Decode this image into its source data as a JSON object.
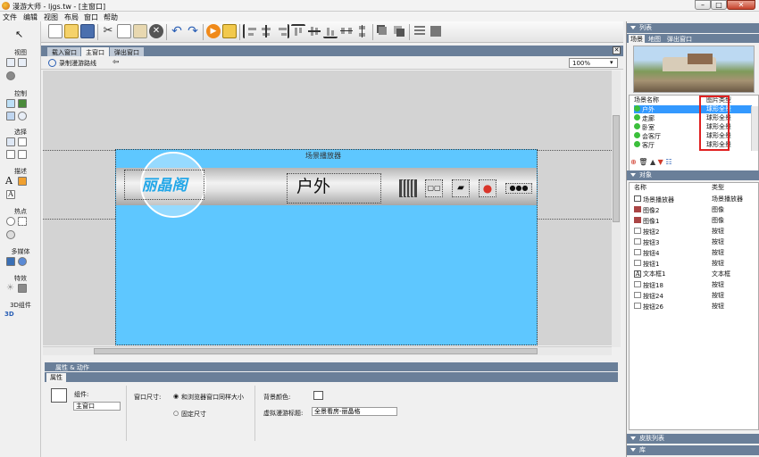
{
  "window": {
    "title": "漫游大师 - ljgs.tw - [主窗口]"
  },
  "menu": [
    "文件",
    "编辑",
    "视图",
    "布局",
    "窗口",
    "帮助"
  ],
  "left_toolbox": {
    "groups": [
      "视图",
      "控制",
      "选择",
      "描述",
      "热点",
      "多媒体",
      "特效",
      "3D组件"
    ]
  },
  "tabs": [
    "载入窗口",
    "主窗口",
    "弹出窗口"
  ],
  "subbar": {
    "record_label": "录制漫游路线",
    "zoom": "100%"
  },
  "canvas": {
    "player_label": "场景播放器",
    "logo_text": "丽晶阁",
    "scene_title": "户外"
  },
  "props": {
    "header": "属性 & 动作",
    "tab": "属性",
    "component_label": "组件:",
    "component_value": "主窗口",
    "window_size_label": "窗口尺寸:",
    "radio1": "和浏览器窗口同样大小",
    "radio2": "固定尺寸",
    "bg_color_label": "背景颜色:",
    "tour_title_label": "虚拟漫游标题:",
    "tour_title_value": "全景看房-丽晶格"
  },
  "right": {
    "list_header": "列表",
    "list_tabs": [
      "场景",
      "地图",
      "弹出窗口"
    ],
    "scene_cols": [
      "场景名称",
      "图片类型"
    ],
    "scenes": [
      {
        "name": "户外",
        "type": "球形全景"
      },
      {
        "name": "走廊",
        "type": "球形全景"
      },
      {
        "name": "卧室",
        "type": "球形全景"
      },
      {
        "name": "会客厅",
        "type": "球形全景"
      },
      {
        "name": "客厅",
        "type": "球形全景"
      }
    ],
    "objects_header": "对象",
    "obj_cols": [
      "名称",
      "类型"
    ],
    "objects": [
      {
        "name": "场景播放器",
        "type": "场景播放器"
      },
      {
        "name": "图像2",
        "type": "图像"
      },
      {
        "name": "图像1",
        "type": "图像"
      },
      {
        "name": "按钮2",
        "type": "按钮"
      },
      {
        "name": "按钮3",
        "type": "按钮"
      },
      {
        "name": "按钮4",
        "type": "按钮"
      },
      {
        "name": "按钮1",
        "type": "按钮"
      },
      {
        "name": "文本框1",
        "type": "文本框"
      },
      {
        "name": "按钮18",
        "type": "按钮"
      },
      {
        "name": "按钮24",
        "type": "按钮"
      },
      {
        "name": "按钮26",
        "type": "按钮"
      }
    ],
    "skin_header": "皮肤列表",
    "lib_header": "库"
  },
  "colors": {
    "accent": "#6a7f99",
    "canvas_blue": "#5ec7ff",
    "highlight": "#3399ff",
    "redbox": "#e02020"
  }
}
